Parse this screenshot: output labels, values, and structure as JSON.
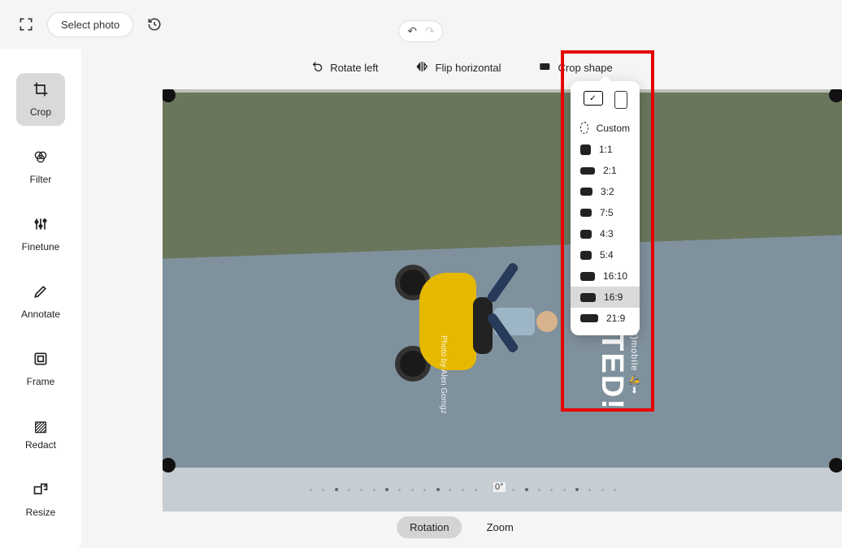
{
  "header": {
    "select_photo": "Select photo"
  },
  "sidebar": {
    "items": [
      {
        "label": "Crop",
        "active": true
      },
      {
        "label": "Filter",
        "active": false
      },
      {
        "label": "Finetune",
        "active": false
      },
      {
        "label": "Annotate",
        "active": false
      },
      {
        "label": "Frame",
        "active": false
      },
      {
        "label": "Redact",
        "active": false
      },
      {
        "label": "Resize",
        "active": false
      }
    ]
  },
  "toolbar": {
    "rotate_left": "Rotate left",
    "flip_horizontal": "Flip horizontal",
    "crop_shape": "Crop shape"
  },
  "crop_shape_menu": {
    "custom": "Custom",
    "ratios": [
      {
        "label": "1:1"
      },
      {
        "label": "2:1"
      },
      {
        "label": "3:2"
      },
      {
        "label": "7:5"
      },
      {
        "label": "4:3"
      },
      {
        "label": "5:4"
      },
      {
        "label": "16:10"
      },
      {
        "label": "16:9",
        "selected": true
      },
      {
        "label": "21:9"
      }
    ]
  },
  "canvas": {
    "overlay_main": "GET STARTED!",
    "overlay_sub": "works just as well on your (scoot)mobile 🛵➡",
    "photo_credit": "Photo by Alen Gomgz",
    "rotation_value": "0°"
  },
  "bottom_tabs": {
    "rotation": "Rotation",
    "zoom": "Zoom"
  }
}
